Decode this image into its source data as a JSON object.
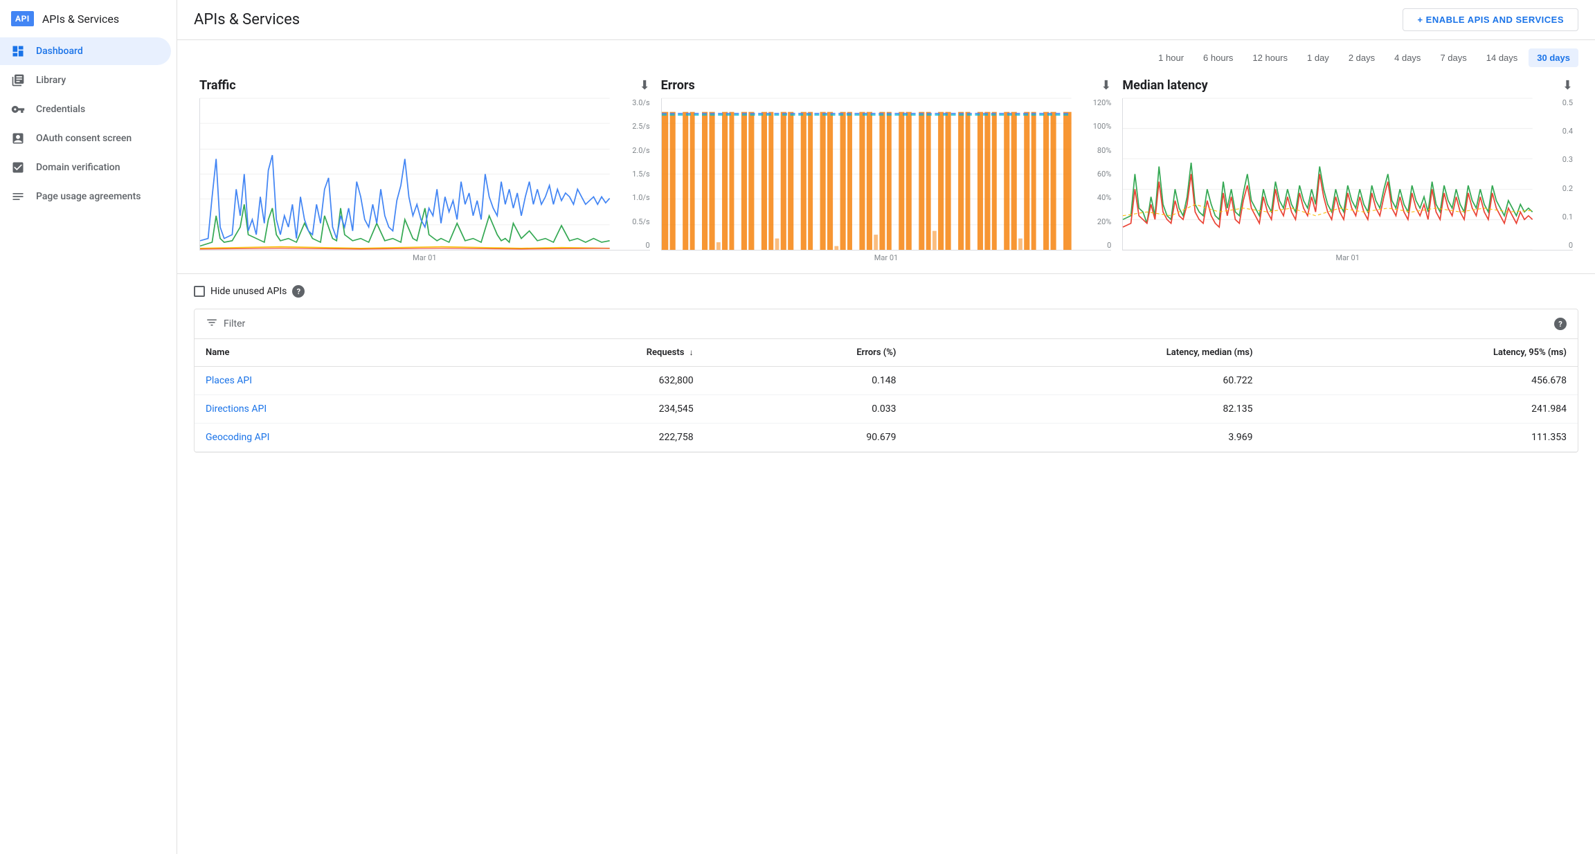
{
  "app": {
    "logo": "API",
    "title": "APIs & Services"
  },
  "sidebar": {
    "items": [
      {
        "id": "dashboard",
        "label": "Dashboard",
        "icon": "dashboard-icon",
        "active": true
      },
      {
        "id": "library",
        "label": "Library",
        "icon": "library-icon",
        "active": false
      },
      {
        "id": "credentials",
        "label": "Credentials",
        "icon": "credentials-icon",
        "active": false
      },
      {
        "id": "oauth",
        "label": "OAuth consent screen",
        "icon": "oauth-icon",
        "active": false
      },
      {
        "id": "domain",
        "label": "Domain verification",
        "icon": "domain-icon",
        "active": false
      },
      {
        "id": "page-usage",
        "label": "Page usage agreements",
        "icon": "page-usage-icon",
        "active": false
      }
    ]
  },
  "header": {
    "title": "APIs & Services",
    "enable_button": "+ ENABLE APIS AND SERVICES"
  },
  "time_filters": {
    "options": [
      "1 hour",
      "6 hours",
      "12 hours",
      "1 day",
      "2 days",
      "4 days",
      "7 days",
      "14 days",
      "30 days"
    ],
    "active": "30 days"
  },
  "charts": {
    "traffic": {
      "title": "Traffic",
      "x_label": "Mar 01",
      "y_labels": [
        "3.0/s",
        "2.5/s",
        "2.0/s",
        "1.5/s",
        "1.0/s",
        "0.5/s",
        "0"
      ]
    },
    "errors": {
      "title": "Errors",
      "x_label": "Mar 01",
      "y_labels": [
        "120%",
        "100%",
        "80%",
        "60%",
        "40%",
        "20%",
        "0"
      ]
    },
    "latency": {
      "title": "Median latency",
      "x_label": "Mar 01",
      "y_labels": [
        "0.5",
        "0.4",
        "0.3",
        "0.2",
        "0.1",
        "0"
      ]
    }
  },
  "table": {
    "hide_unused_label": "Hide unused APIs",
    "filter_label": "Filter",
    "help_icon": "?",
    "columns": [
      {
        "id": "name",
        "label": "Name",
        "sortable": true
      },
      {
        "id": "requests",
        "label": "Requests",
        "sortable": true
      },
      {
        "id": "errors",
        "label": "Errors (%)",
        "sortable": false
      },
      {
        "id": "latency_median",
        "label": "Latency, median (ms)",
        "sortable": false
      },
      {
        "id": "latency_95",
        "label": "Latency, 95% (ms)",
        "sortable": false
      }
    ],
    "rows": [
      {
        "name": "Places API",
        "requests": "632,800",
        "errors": "0.148",
        "latency_median": "60.722",
        "latency_95": "456.678"
      },
      {
        "name": "Directions API",
        "requests": "234,545",
        "errors": "0.033",
        "latency_median": "82.135",
        "latency_95": "241.984"
      },
      {
        "name": "Geocoding API",
        "requests": "222,758",
        "errors": "90.679",
        "latency_median": "3.969",
        "latency_95": "111.353"
      }
    ]
  }
}
